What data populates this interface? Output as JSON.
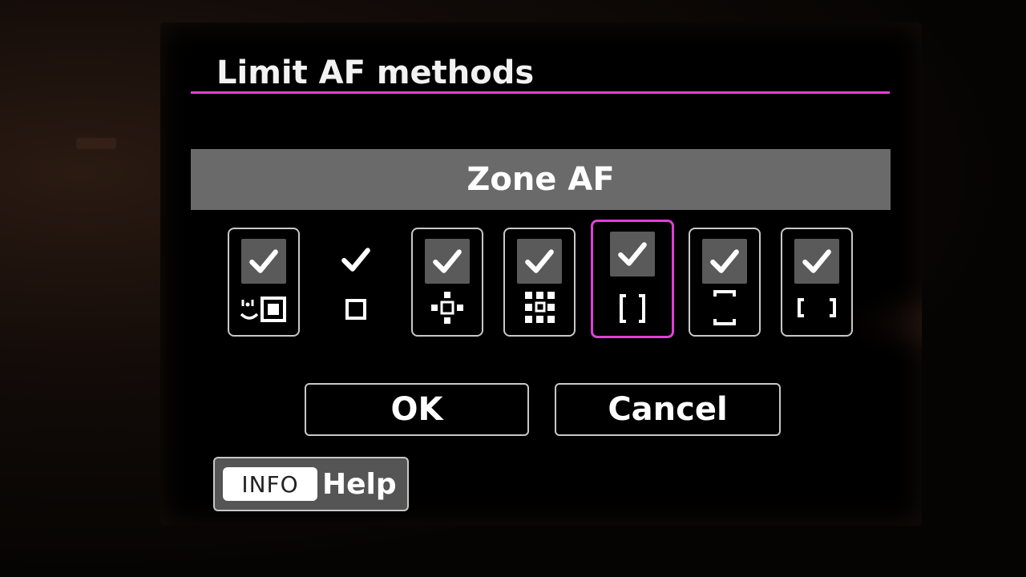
{
  "screen": {
    "title": "Limit AF methods",
    "mode_label": "Zone AF"
  },
  "af_methods": [
    {
      "icon": "face-tracking-af-icon",
      "checked": true,
      "selected": false
    },
    {
      "icon": "spot-af-icon",
      "checked": true,
      "selected": false
    },
    {
      "icon": "expand-af-cross-icon",
      "checked": true,
      "selected": false
    },
    {
      "icon": "expand-af-around-icon",
      "checked": true,
      "selected": false
    },
    {
      "icon": "zone-af-icon",
      "checked": true,
      "selected": true
    },
    {
      "icon": "large-zone-af-vertical-icon",
      "checked": true,
      "selected": false
    },
    {
      "icon": "large-zone-af-horizontal-icon",
      "checked": true,
      "selected": false
    }
  ],
  "buttons": {
    "ok": "OK",
    "cancel": "Cancel"
  },
  "help": {
    "key": "INFO",
    "label": "Help"
  },
  "colors": {
    "accent": "#e040d8",
    "mode_bar": "#6a6a6a",
    "check_bg": "#5a5a5a"
  }
}
